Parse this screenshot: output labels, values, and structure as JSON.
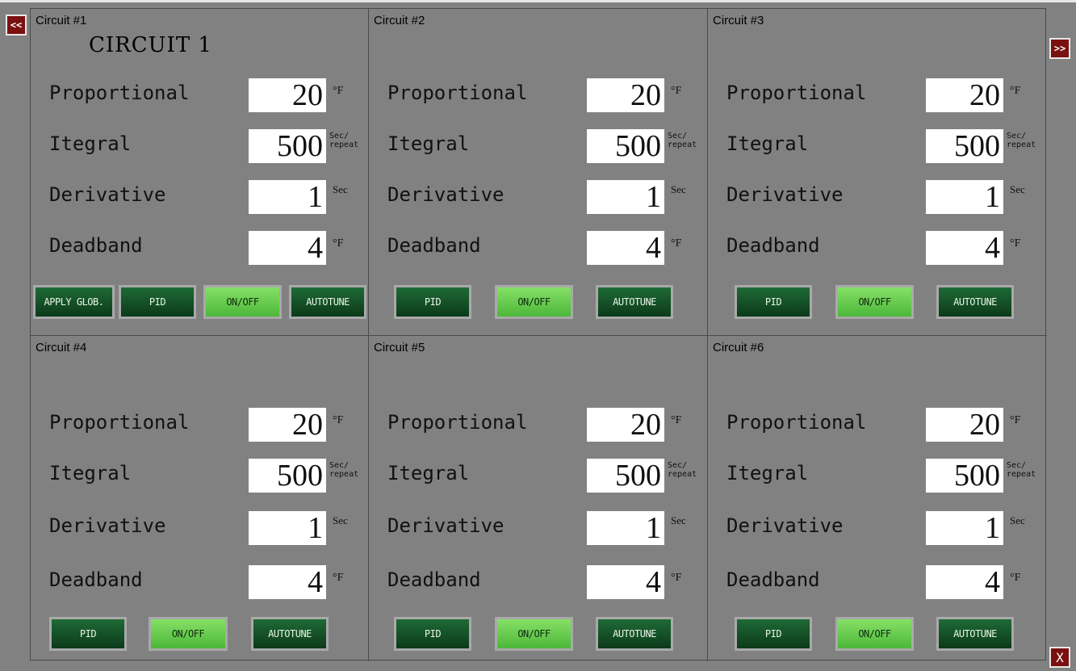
{
  "nav": {
    "prev_label": "<<",
    "next_label": ">>",
    "close_label": "X"
  },
  "circuits": [
    {
      "title": "Circuit #1",
      "subtitle": "CIRCUIT 1",
      "params": [
        {
          "label": "Proportional",
          "value": "20",
          "unit": "°F"
        },
        {
          "label": "Itegral",
          "value": "500",
          "unit_top": "Sec/",
          "unit_bottom": "repeat"
        },
        {
          "label": "Derivative",
          "value": "1",
          "unit": "Sec"
        },
        {
          "label": "Deadband",
          "value": "4",
          "unit": "°F"
        }
      ],
      "buttons": {
        "apply": "APPLY GLOB.",
        "pid": "PID",
        "onoff": "ON/OFF",
        "autotune": "AUTOTUNE"
      }
    },
    {
      "title": "Circuit #2",
      "subtitle": "",
      "params": [
        {
          "label": "Proportional",
          "value": "20",
          "unit": "°F"
        },
        {
          "label": "Itegral",
          "value": "500",
          "unit_top": "Sec/",
          "unit_bottom": "repeat"
        },
        {
          "label": "Derivative",
          "value": "1",
          "unit": "Sec"
        },
        {
          "label": "Deadband",
          "value": "4",
          "unit": "°F"
        }
      ],
      "buttons": {
        "pid": "PID",
        "onoff": "ON/OFF",
        "autotune": "AUTOTUNE"
      }
    },
    {
      "title": "Circuit #3",
      "subtitle": "",
      "params": [
        {
          "label": "Proportional",
          "value": "20",
          "unit": "°F"
        },
        {
          "label": "Itegral",
          "value": "500",
          "unit_top": "Sec/",
          "unit_bottom": "repeat"
        },
        {
          "label": "Derivative",
          "value": "1",
          "unit": "Sec"
        },
        {
          "label": "Deadband",
          "value": "4",
          "unit": "°F"
        }
      ],
      "buttons": {
        "pid": "PID",
        "onoff": "ON/OFF",
        "autotune": "AUTOTUNE"
      }
    },
    {
      "title": "Circuit #4",
      "subtitle": "",
      "params": [
        {
          "label": "Proportional",
          "value": "20",
          "unit": "°F"
        },
        {
          "label": "Itegral",
          "value": "500",
          "unit_top": "Sec/",
          "unit_bottom": "repeat"
        },
        {
          "label": "Derivative",
          "value": "1",
          "unit": "Sec"
        },
        {
          "label": "Deadband",
          "value": "4",
          "unit": "°F"
        }
      ],
      "buttons": {
        "pid": "PID",
        "onoff": "ON/OFF",
        "autotune": "AUTOTUNE"
      }
    },
    {
      "title": "Circuit #5",
      "subtitle": "",
      "params": [
        {
          "label": "Proportional",
          "value": "20",
          "unit": "°F"
        },
        {
          "label": "Itegral",
          "value": "500",
          "unit_top": "Sec/",
          "unit_bottom": "repeat"
        },
        {
          "label": "Derivative",
          "value": "1",
          "unit": "Sec"
        },
        {
          "label": "Deadband",
          "value": "4",
          "unit": "°F"
        }
      ],
      "buttons": {
        "pid": "PID",
        "onoff": "ON/OFF",
        "autotune": "AUTOTUNE"
      }
    },
    {
      "title": "Circuit #6",
      "subtitle": "",
      "params": [
        {
          "label": "Proportional",
          "value": "20",
          "unit": "°F"
        },
        {
          "label": "Itegral",
          "value": "500",
          "unit_top": "Sec/",
          "unit_bottom": "repeat"
        },
        {
          "label": "Derivative",
          "value": "1",
          "unit": "Sec"
        },
        {
          "label": "Deadband",
          "value": "4",
          "unit": "°F"
        }
      ],
      "buttons": {
        "pid": "PID",
        "onoff": "ON/OFF",
        "autotune": "AUTOTUNE"
      }
    }
  ],
  "colors": {
    "background": "#818181",
    "button_dark": "#0f4a22",
    "button_light": "#5fcb45",
    "nav_red": "#7a1010"
  }
}
